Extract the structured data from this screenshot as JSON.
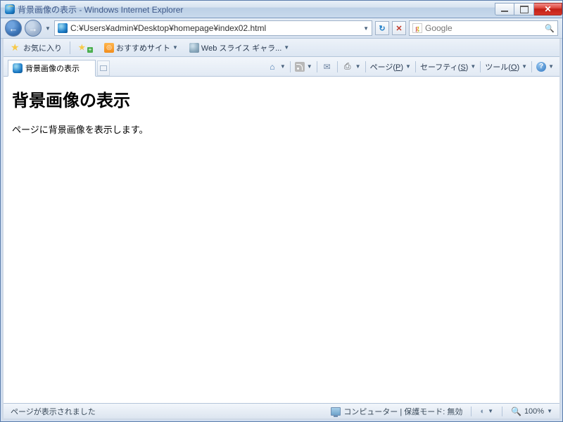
{
  "window": {
    "title": "背景画像の表示 - Windows Internet Explorer"
  },
  "nav": {
    "url": "C:¥Users¥admin¥Desktop¥homepage¥index02.html",
    "search_placeholder": "Google"
  },
  "favorites": {
    "label": "お気に入り",
    "recommended": "おすすめサイト",
    "webslice": "Web スライス ギャラ..."
  },
  "tab": {
    "title": "背景画像の表示"
  },
  "cmdbar": {
    "page": "ページ(",
    "page_u": "P",
    "safety": "セーフティ(",
    "safety_u": "S",
    "tools": "ツール(",
    "tools_u": "O",
    "close_paren": ")"
  },
  "page": {
    "heading": "背景画像の表示",
    "body": "ページに背景画像を表示します。"
  },
  "status": {
    "done": "ページが表示されました",
    "zone": "コンピューター | 保護モード: 無効",
    "zoom": "100%"
  }
}
